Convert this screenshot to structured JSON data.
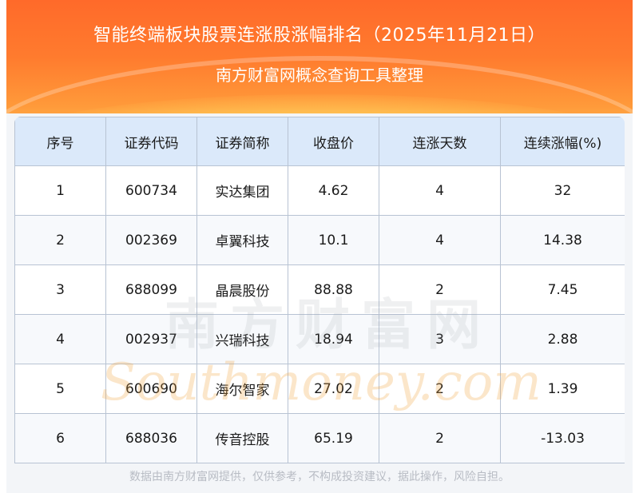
{
  "header": {
    "title": "智能终端板块股票连涨股涨幅排名（2025年11月21日）",
    "subtitle": "南方财富网概念查询工具整理"
  },
  "table": {
    "columns": [
      "序号",
      "证券代码",
      "证券简称",
      "收盘价",
      "连涨天数",
      "连续涨幅(%)"
    ],
    "rows": [
      [
        "1",
        "600734",
        "实达集团",
        "4.62",
        "4",
        "32"
      ],
      [
        "2",
        "002369",
        "卓翼科技",
        "10.1",
        "4",
        "14.38"
      ],
      [
        "3",
        "688099",
        "晶晨股份",
        "88.88",
        "2",
        "7.45"
      ],
      [
        "4",
        "002937",
        "兴瑞科技",
        "18.94",
        "3",
        "2.88"
      ],
      [
        "5",
        "600690",
        "海尔智家",
        "27.02",
        "2",
        "1.39"
      ],
      [
        "6",
        "688036",
        "传音控股",
        "65.19",
        "2",
        "-13.03"
      ]
    ]
  },
  "watermark": {
    "cn": "南方财富网",
    "en": "Southmoney.com"
  },
  "footer": {
    "disclaimer": "数据由南方财富网提供，仅供参考，不构成投资建议，据此操作，风险自担。"
  },
  "colors": {
    "banner": "#ff7b2e",
    "header_row": "#dbe9fa",
    "grid": "#b8c3d3",
    "footer_text": "#b8bcc4"
  }
}
